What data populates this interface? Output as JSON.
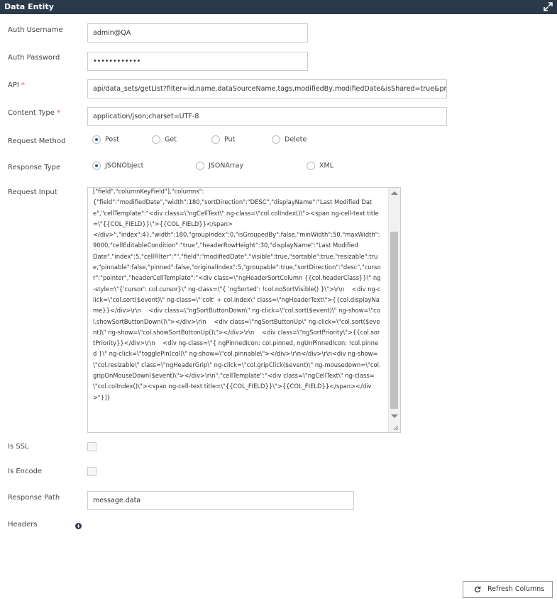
{
  "window": {
    "title": "Data Entity",
    "expand_icon": "expand-icon"
  },
  "form": {
    "auth_username": {
      "label": "Auth Username",
      "value": "admin@QA"
    },
    "auth_password": {
      "label": "Auth Password",
      "value": "••••••••••••"
    },
    "api": {
      "label": "API",
      "required": "*",
      "value": "api/data_sets/getList?filter=id,name,dataSourceName,tags,modifiedBy,modifiedDate&isShared=true&proje"
    },
    "content_type": {
      "label": "Content Type",
      "required": "*",
      "value": "application/json;charset=UTF-8"
    },
    "request_method": {
      "label": "Request Method",
      "options": [
        "Post",
        "Get",
        "Put",
        "Delete"
      ],
      "selected": "Post"
    },
    "response_type": {
      "label": "Response Type",
      "options": [
        "JSONObject",
        "JSONArray",
        "XML"
      ],
      "selected": "JSONObject"
    },
    "request_input": {
      "label": "Request Input",
      "value": "[\"field\",\"columnKeyField\"],\"columns\":\n{\"field\":\"modifiedDate\",\"width\":180,\"sortDirection\":\"DESC\",\"displayName\":\"Last Modified Date\",\"cellTemplate\":\"<div class=\\\"ngCellText\\\" ng-class=\\\"col.colIndex()\\\"><span ng-cell-text title=\\\"{{COL_FIELD}}\\\">{{COL_FIELD}}</span>\n</div>\",\"index\":4},\"width\":180,\"groupIndex\":0,\"isGroupedBy\":false,\"minWidth\":50,\"maxWidth\":9000,\"cellEditableCondition\":\"true\",\"headerRowHeight\":30,\"displayName\":\"Last Modified\nDate\",\"index\":5,\"cellFilter\":\"\",\"field\":\"modifiedDate\",\"visible\":true,\"sortable\":true,\"resizable\":true,\"pinnable\":false,\"pinned\":false,\"originalIndex\":5,\"groupable\":true,\"sortDirection\":\"desc\",\"cursor\":\"pointer\",\"headerCellTemplate\":\"<div class=\\\"ngHeaderSortColumn {{col.headerClass}}\\\" ng-style=\\\"{'cursor': col.cursor}\\\" ng-class=\\\"{ 'ngSorted': !col.noSortVisible() }\\\">\\r\\n    <div ng-click=\\\"col.sort($event)\\\" ng-class=\\\"'colt' + col.index\\\" class=\\\"ngHeaderText\\\">{{col.displayName}}</div>\\r\\n    <div class=\\\"ngSortButtonDown\\\" ng-click=\\\"col.sort($event)\\\" ng-show=\\\"col.showSortButtonDown()\\\"></div>\\r\\n    <div class=\\\"ngSortButtonUp\\\" ng-click=\\\"col.sort($event)\\\" ng-show=\\\"col.showSortButtonUp()\\\"></div>\\r\\n    <div class=\\\"ngSortPriority\\\">{{col.sortPriority}}</div>\\r\\n    <div ng-class=\\\"{ ngPinnedIcon: col.pinned, ngUnPinnedIcon: !col.pinned }\\\" ng-click=\\\"togglePin(col)\\\" ng-show=\\\"col.pinnable\\\"></div>\\r\\n</div>\\r\\n<div ng-show=\\\"col.resizable\\\" class=\\\"ngHeaderGrip\\\" ng-click=\\\"col.gripClick($event)\\\" ng-mousedown=\\\"col.gripOnMouseDown($event)\\\"></div>\\r\\n\",\"cellTemplate\":\"<div class=\\\"ngCellText\\\" ng-class=\\\"col.colIndex()\\\"><span ng-cell-text title=\\\"{{COL_FIELD}}\\\">{{COL_FIELD}}</span></div>\"}]}"
    },
    "is_ssl": {
      "label": "Is SSL"
    },
    "is_encode": {
      "label": "Is Encode"
    },
    "response_path": {
      "label": "Response Path",
      "value": "message.data"
    },
    "headers": {
      "label": "Headers",
      "add_icon": "add-circle-icon"
    }
  },
  "actions": {
    "refresh_columns": "Refresh Columns",
    "refresh_icon": "refresh-icon"
  },
  "colors": {
    "titlebar": "#2b3a4a",
    "required": "#d9534f",
    "radio_selected": "#2b5b8a"
  }
}
